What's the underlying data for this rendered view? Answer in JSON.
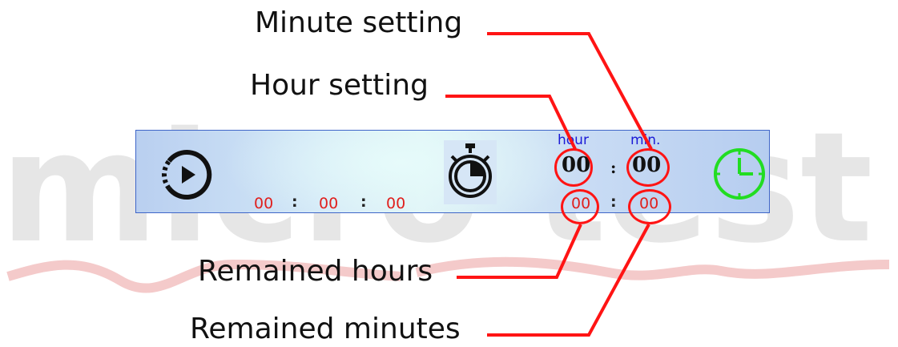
{
  "watermark": "micro test",
  "callouts": {
    "minute_setting": "Minute setting",
    "hour_setting": "Hour setting",
    "remained_hours": "Remained hours",
    "remained_minutes": "Remained minutes"
  },
  "panel": {
    "elapsed": {
      "h": "00",
      "m": "00",
      "s": "00",
      "sep": ":"
    },
    "set_labels": {
      "hour": "hour",
      "min": "min."
    },
    "set_values": {
      "hour": "00",
      "min": "00",
      "sep": ":"
    },
    "remaining": {
      "hour": "00",
      "min": "00",
      "sep": ":"
    }
  },
  "colors": {
    "callout_line": "#ff1414",
    "elapsed_text": "#e0201e",
    "label_text": "#1a1ad6",
    "clock_icon": "#22dd22"
  }
}
